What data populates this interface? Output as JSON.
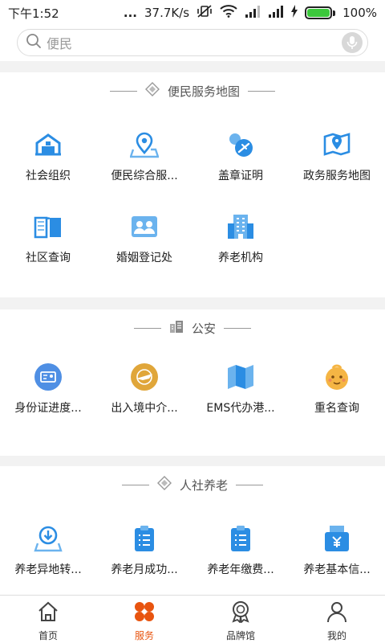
{
  "status_bar": {
    "time": "下午1:52",
    "dots": "...",
    "speed": "37.7K/s",
    "battery": "100%"
  },
  "search": {
    "placeholder": "便民"
  },
  "sections": [
    {
      "title": "便民服务地图",
      "items": [
        "社会组织",
        "便民综合服...",
        "盖章证明",
        "政务服务地图",
        "社区查询",
        "婚姻登记处",
        "养老机构"
      ]
    },
    {
      "title": "公安",
      "items": [
        "身份证进度...",
        "出入境中介...",
        "EMS代办港...",
        "重名查询"
      ]
    },
    {
      "title": "人社养老",
      "items": [
        "养老异地转...",
        "养老月成功...",
        "养老年缴费...",
        "养老基本信..."
      ]
    }
  ],
  "tabs": [
    {
      "label": "首页",
      "icon": "home-icon"
    },
    {
      "label": "服务",
      "icon": "services-icon"
    },
    {
      "label": "品牌馆",
      "icon": "brand-medal-icon"
    },
    {
      "label": "我的",
      "icon": "profile-icon"
    }
  ],
  "colors": {
    "blue": "#2b8de3",
    "orange": "#e8540f",
    "gold": "#e0a63a"
  }
}
